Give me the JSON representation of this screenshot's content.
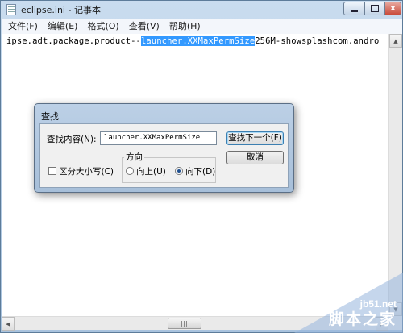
{
  "window": {
    "title": "eclipse.ini - 记事本",
    "close_symbol": "x"
  },
  "menu": [
    {
      "label": "文件(F)"
    },
    {
      "label": "编辑(E)"
    },
    {
      "label": "格式(O)"
    },
    {
      "label": "查看(V)"
    },
    {
      "label": "帮助(H)"
    }
  ],
  "editor": {
    "text_before": "ipse.adt.package.product--",
    "selected_text": "launcher.XXMaxPermSize",
    "text_after": "256M-showsplashcom.andro"
  },
  "find_dialog": {
    "title": "查找",
    "find_what_label": "查找内容(N):",
    "find_what_value": "launcher.XXMaxPermSize",
    "find_next_button": "查找下一个(F)",
    "cancel_button": "取消",
    "direction_label": "方向",
    "up_label": "向上(U)",
    "down_label": "向下(D)",
    "match_case_label": "区分大小写(C)",
    "direction_selected": "down",
    "match_case_checked": false
  },
  "watermark": {
    "url": "jb51.net",
    "name": "脚本之家"
  },
  "icons": {
    "app": "notepad-icon",
    "minimize": "minimize-icon",
    "maximize": "maximize-icon",
    "close": "close-icon"
  },
  "colors": {
    "selection": "#3399ff",
    "titlebar": "#b9d0e8",
    "close_button": "#c94b3b"
  }
}
